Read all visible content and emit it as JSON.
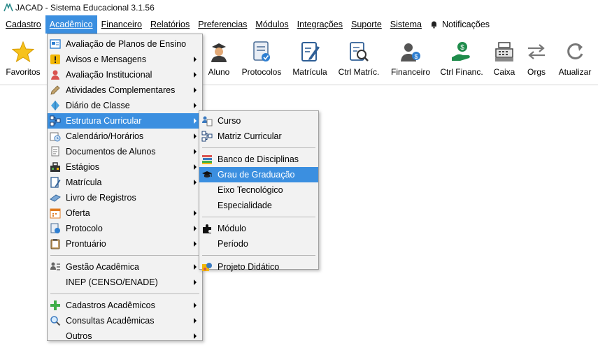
{
  "app": {
    "title": "JACAD - Sistema Educacional 3.1.56"
  },
  "menubar": {
    "items": [
      {
        "label": "Cadastro"
      },
      {
        "label": "Acadêmico"
      },
      {
        "label": "Financeiro"
      },
      {
        "label": "Relatórios"
      },
      {
        "label": "Preferencias"
      },
      {
        "label": "Módulos"
      },
      {
        "label": "Integrações"
      },
      {
        "label": "Suporte"
      },
      {
        "label": "Sistema"
      }
    ],
    "notifications": "Notificações"
  },
  "toolbar": {
    "buttons": [
      {
        "label": "Favoritos",
        "icon": "star-icon"
      },
      {
        "label": "Aluno",
        "icon": "student-icon"
      },
      {
        "label": "Protocolos",
        "icon": "protocol-icon"
      },
      {
        "label": "Matrícula",
        "icon": "enrollment-icon"
      },
      {
        "label": "Ctrl Matríc.",
        "icon": "enrollment-control-icon"
      },
      {
        "label": "Financeiro",
        "icon": "finance-user-icon"
      },
      {
        "label": "Ctrl Financ.",
        "icon": "finance-control-icon"
      },
      {
        "label": "Caixa",
        "icon": "cash-register-icon"
      },
      {
        "label": "Orgs",
        "icon": "swap-arrows-icon"
      },
      {
        "label": "Atualizar",
        "icon": "refresh-icon"
      }
    ]
  },
  "academico_menu": {
    "items": [
      {
        "label": "Avaliação de Planos de Ensino",
        "icon": "plan-icon"
      },
      {
        "label": "Avisos e Mensagens",
        "icon": "warning-icon"
      },
      {
        "label": "Avaliação Institucional",
        "icon": "evaluation-icon"
      },
      {
        "label": "Atividades Complementares",
        "icon": "pencil-icon"
      },
      {
        "label": "Diário de Classe",
        "icon": "diary-icon"
      },
      {
        "label": "Estrutura Curricular",
        "icon": "structure-icon"
      },
      {
        "label": "Calendário/Horários",
        "icon": "calendar-clock-icon"
      },
      {
        "label": "Documentos de Alunos",
        "icon": "documents-icon"
      },
      {
        "label": "Estágios",
        "icon": "internship-icon"
      },
      {
        "label": "Matrícula",
        "icon": "enrollment-icon"
      },
      {
        "label": "Livro de Registros",
        "icon": "book-icon"
      },
      {
        "label": "Oferta",
        "icon": "offer-calendar-icon"
      },
      {
        "label": "Protocolo",
        "icon": "protocol-icon"
      },
      {
        "label": "Prontuário",
        "icon": "clipboard-icon"
      },
      {
        "label": "Gestão Acadêmica",
        "icon": "management-icon"
      },
      {
        "label": "INEP (CENSO/ENADE)"
      },
      {
        "label": "Cadastros Acadêmicos",
        "icon": "plus-icon"
      },
      {
        "label": "Consultas Acadêmicas",
        "icon": "search-icon"
      },
      {
        "label": "Outros"
      }
    ]
  },
  "estrutura_submenu": {
    "items": [
      {
        "label": "Curso",
        "icon": "course-icon"
      },
      {
        "label": "Matriz Curricular",
        "icon": "matrix-icon"
      },
      {
        "label": "Banco de Disciplinas",
        "icon": "books-icon"
      },
      {
        "label": "Grau de Graduação",
        "icon": "graduation-cap-icon"
      },
      {
        "label": "Eixo Tecnológico"
      },
      {
        "label": "Especialidade"
      },
      {
        "label": "Módulo",
        "icon": "puzzle-icon"
      },
      {
        "label": "Período"
      },
      {
        "label": "Projeto Didático",
        "icon": "project-icon"
      }
    ]
  },
  "colors": {
    "highlight": "#3b8fe0",
    "menu_bg": "#f2f2f2"
  }
}
